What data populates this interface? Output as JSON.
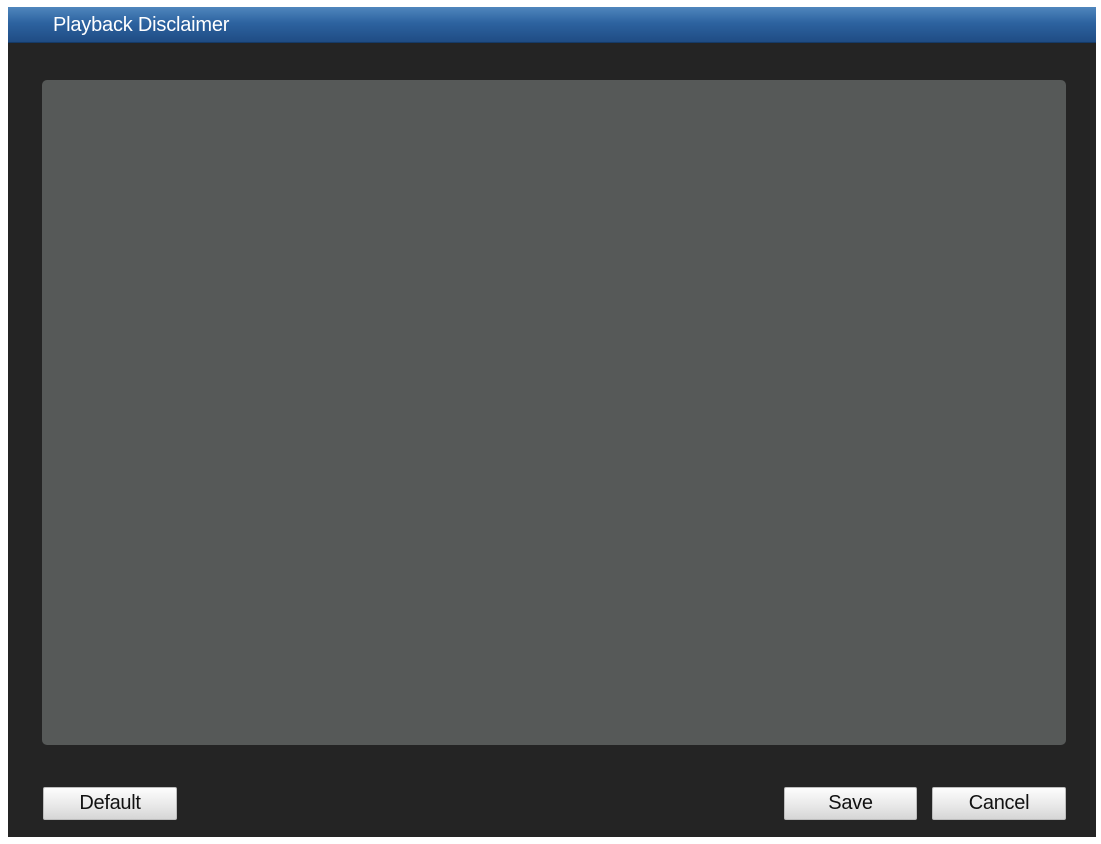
{
  "dialog": {
    "title": "Playback Disclaimer",
    "disclaimer_text": ""
  },
  "buttons": {
    "default_label": "Default",
    "save_label": "Save",
    "cancel_label": "Cancel"
  },
  "colors": {
    "title_bar": "#2d63a0",
    "dialog_background": "#242424",
    "text_area_background": "#565958",
    "button_background": "#e9e9e9"
  }
}
